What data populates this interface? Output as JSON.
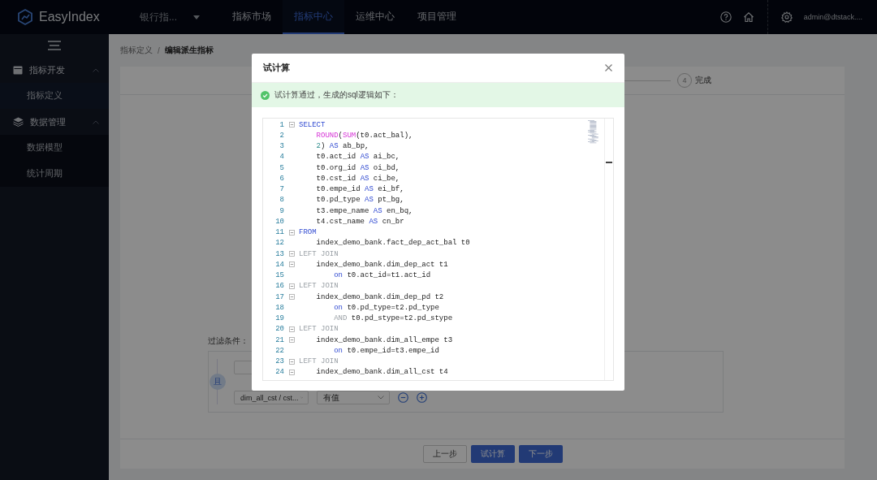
{
  "app": {
    "name": "EasyIndex",
    "project": "银行指...",
    "user": "admin@dtstack...."
  },
  "nav": [
    {
      "label": "指标市场",
      "selected": false
    },
    {
      "label": "指标中心",
      "selected": true
    },
    {
      "label": "运维中心",
      "selected": false
    },
    {
      "label": "项目管理",
      "selected": false
    }
  ],
  "sidebar": {
    "groups": [
      {
        "label": "指标开发",
        "expanded": true,
        "children": [
          {
            "label": "指标定义",
            "selected": true
          }
        ]
      },
      {
        "label": "数据管理",
        "expanded": true,
        "children": [
          {
            "label": "数据模型",
            "selected": false
          },
          {
            "label": "统计周期",
            "selected": false
          }
        ]
      }
    ]
  },
  "breadcrumb": {
    "separator": "/",
    "items": [
      "指标定义",
      "编辑派生指标"
    ]
  },
  "steps": [
    {
      "number": "4",
      "label": "完成"
    }
  ],
  "filter": {
    "label": "过滤条件：",
    "logic": "且",
    "field": "dim_all_cst / cst...",
    "operator": "有值"
  },
  "footer_buttons": [
    {
      "label": "上一步",
      "kind": "default"
    },
    {
      "label": "试计算",
      "kind": "primary"
    },
    {
      "label": "下一步",
      "kind": "primary"
    }
  ],
  "modal": {
    "title": "试计算",
    "message": "试计算通过，生成的sql逻辑如下：",
    "code": [
      {
        "number": "1",
        "foldable": true,
        "tokens": [
          {
            "kind": "keyword",
            "text": "SELECT"
          }
        ]
      },
      {
        "number": "2",
        "foldable": false,
        "tokens": [
          {
            "kind": "function",
            "text": "    ROUND"
          },
          {
            "kind": "plain",
            "text": "("
          },
          {
            "kind": "function",
            "text": "SUM"
          },
          {
            "kind": "plain",
            "text": "(t0.act_bal),"
          }
        ]
      },
      {
        "number": "3",
        "foldable": false,
        "tokens": [
          {
            "kind": "number",
            "text": "    2"
          },
          {
            "kind": "plain",
            "text": ") "
          },
          {
            "kind": "keyword",
            "text": "AS"
          },
          {
            "kind": "plain",
            "text": " ab_bp,"
          }
        ]
      },
      {
        "number": "4",
        "foldable": false,
        "tokens": [
          {
            "kind": "plain",
            "text": "    t0.act_id "
          },
          {
            "kind": "keyword",
            "text": "AS"
          },
          {
            "kind": "plain",
            "text": " ai_bc,"
          }
        ]
      },
      {
        "number": "5",
        "foldable": false,
        "tokens": [
          {
            "kind": "plain",
            "text": "    t0.org_id "
          },
          {
            "kind": "keyword",
            "text": "AS"
          },
          {
            "kind": "plain",
            "text": " oi_bd,"
          }
        ]
      },
      {
        "number": "6",
        "foldable": false,
        "tokens": [
          {
            "kind": "plain",
            "text": "    t0.cst_id "
          },
          {
            "kind": "keyword",
            "text": "AS"
          },
          {
            "kind": "plain",
            "text": " ci_be,"
          }
        ]
      },
      {
        "number": "7",
        "foldable": false,
        "tokens": [
          {
            "kind": "plain",
            "text": "    t0.empe_id "
          },
          {
            "kind": "keyword",
            "text": "AS"
          },
          {
            "kind": "plain",
            "text": " ei_bf,"
          }
        ]
      },
      {
        "number": "8",
        "foldable": false,
        "tokens": [
          {
            "kind": "plain",
            "text": "    t0.pd_type "
          },
          {
            "kind": "keyword",
            "text": "AS"
          },
          {
            "kind": "plain",
            "text": " pt_bg,"
          }
        ]
      },
      {
        "number": "9",
        "foldable": false,
        "tokens": [
          {
            "kind": "plain",
            "text": "    t3.empe_name "
          },
          {
            "kind": "keyword",
            "text": "AS"
          },
          {
            "kind": "plain",
            "text": " en_bq,"
          }
        ]
      },
      {
        "number": "10",
        "foldable": false,
        "tokens": [
          {
            "kind": "plain",
            "text": "    t4.cst_name "
          },
          {
            "kind": "keyword",
            "text": "AS"
          },
          {
            "kind": "plain",
            "text": " cn_br"
          }
        ]
      },
      {
        "number": "11",
        "foldable": true,
        "tokens": [
          {
            "kind": "keyword",
            "text": "FROM"
          }
        ]
      },
      {
        "number": "12",
        "foldable": false,
        "tokens": [
          {
            "kind": "plain",
            "text": "    index_demo_bank.fact_dep_act_bal t0"
          }
        ]
      },
      {
        "number": "13",
        "foldable": true,
        "tokens": [
          {
            "kind": "muted",
            "text": "LEFT JOIN"
          }
        ]
      },
      {
        "number": "14",
        "foldable": true,
        "tokens": [
          {
            "kind": "plain",
            "text": "    index_demo_bank.dim_dep_act t1"
          }
        ]
      },
      {
        "number": "15",
        "foldable": false,
        "tokens": [
          {
            "kind": "keyword",
            "text": "        on"
          },
          {
            "kind": "plain",
            "text": " t0.act_id=t1.act_id"
          }
        ]
      },
      {
        "number": "16",
        "foldable": true,
        "tokens": [
          {
            "kind": "muted",
            "text": "LEFT JOIN"
          }
        ]
      },
      {
        "number": "17",
        "foldable": true,
        "tokens": [
          {
            "kind": "plain",
            "text": "    index_demo_bank.dim_dep_pd t2"
          }
        ]
      },
      {
        "number": "18",
        "foldable": false,
        "tokens": [
          {
            "kind": "keyword",
            "text": "        on"
          },
          {
            "kind": "plain",
            "text": " t0.pd_type=t2.pd_type"
          }
        ]
      },
      {
        "number": "19",
        "foldable": false,
        "tokens": [
          {
            "kind": "muted",
            "text": "        AND"
          },
          {
            "kind": "plain",
            "text": " t0.pd_stype=t2.pd_stype"
          }
        ]
      },
      {
        "number": "20",
        "foldable": true,
        "tokens": [
          {
            "kind": "muted",
            "text": "LEFT JOIN"
          }
        ]
      },
      {
        "number": "21",
        "foldable": true,
        "tokens": [
          {
            "kind": "plain",
            "text": "    index_demo_bank.dim_all_empe t3"
          }
        ]
      },
      {
        "number": "22",
        "foldable": false,
        "tokens": [
          {
            "kind": "keyword",
            "text": "        on"
          },
          {
            "kind": "plain",
            "text": " t0.empe_id=t3.empe_id"
          }
        ]
      },
      {
        "number": "23",
        "foldable": true,
        "tokens": [
          {
            "kind": "muted",
            "text": "LEFT JOIN"
          }
        ]
      },
      {
        "number": "24",
        "foldable": true,
        "tokens": [
          {
            "kind": "plain",
            "text": "    index_demo_bank.dim_all_cst t4"
          }
        ]
      }
    ]
  }
}
